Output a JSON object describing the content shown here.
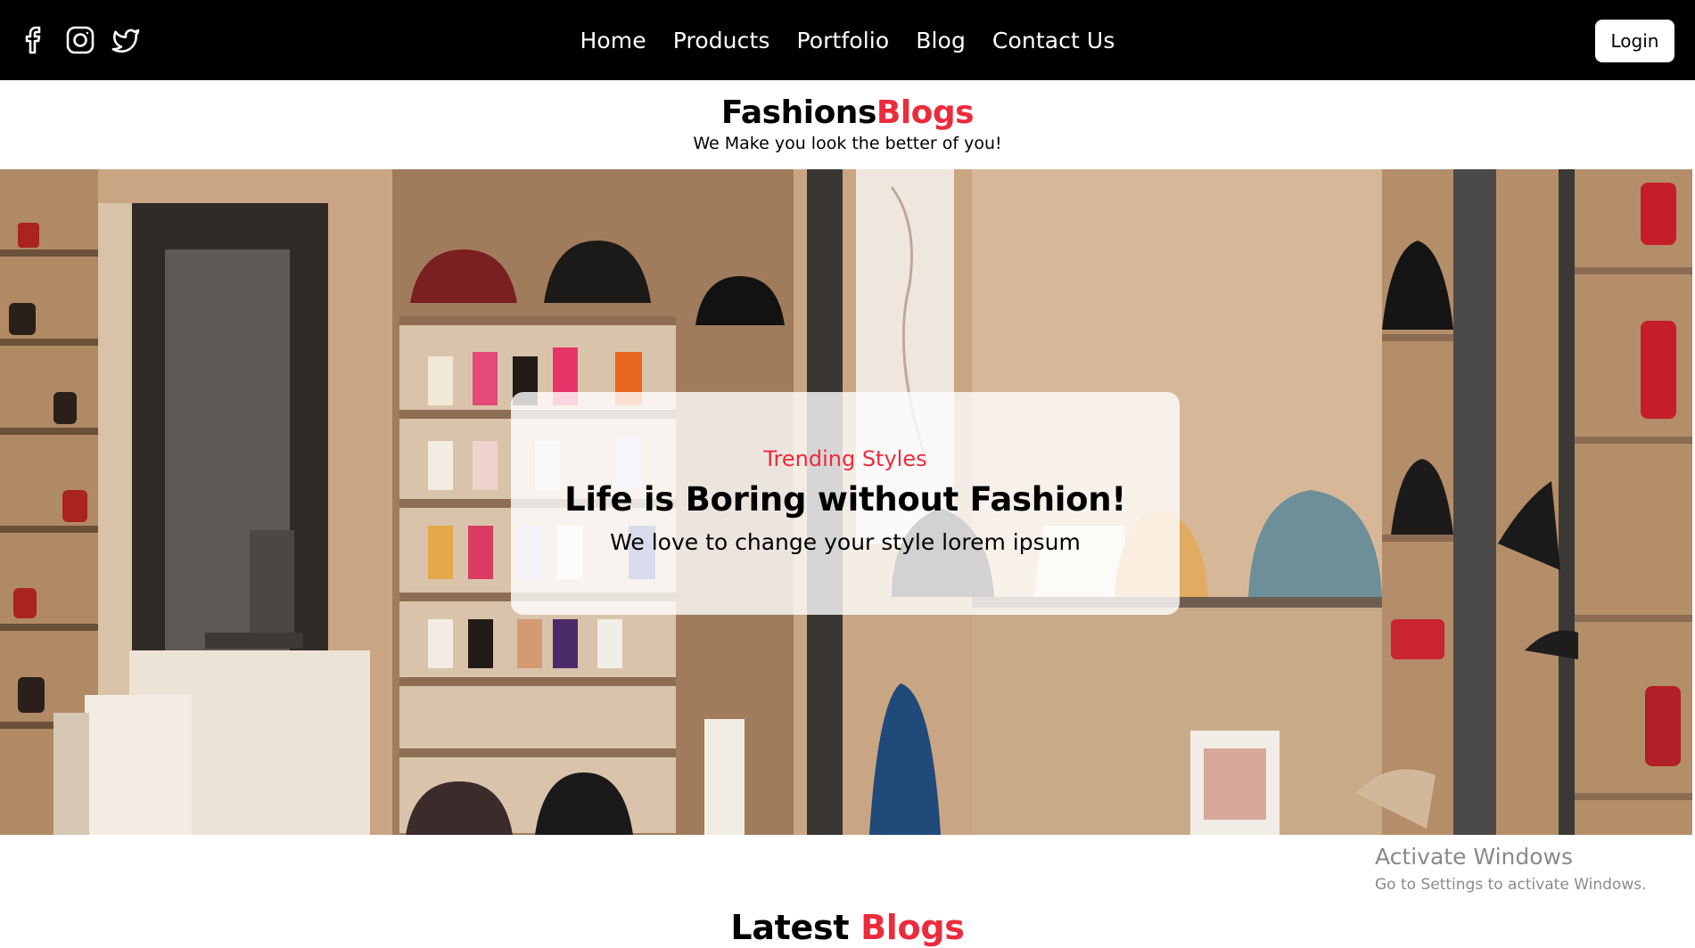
{
  "navbar": {
    "socials": [
      {
        "icon": "facebook-icon"
      },
      {
        "icon": "instagram-icon"
      },
      {
        "icon": "twitter-icon"
      }
    ],
    "links": [
      "Home",
      "Products",
      "Portfolio",
      "Blog",
      "Contact Us"
    ],
    "login_label": "Login"
  },
  "brand": {
    "title_main": "Fashions",
    "title_accent": "Blogs",
    "tagline": "We Make you look the better of you!"
  },
  "hero": {
    "kicker": "Trending Styles",
    "heading": "Life is Boring without Fashion!",
    "subheading": "We love to change your style lorem ipsum"
  },
  "watermark": {
    "title": "Activate Windows",
    "subtitle": "Go to Settings to activate Windows."
  },
  "latest": {
    "title_main": "Latest",
    "title_accent": "Blogs"
  },
  "colors": {
    "accent": "#ec2b3c",
    "navbar_bg": "#000000"
  }
}
